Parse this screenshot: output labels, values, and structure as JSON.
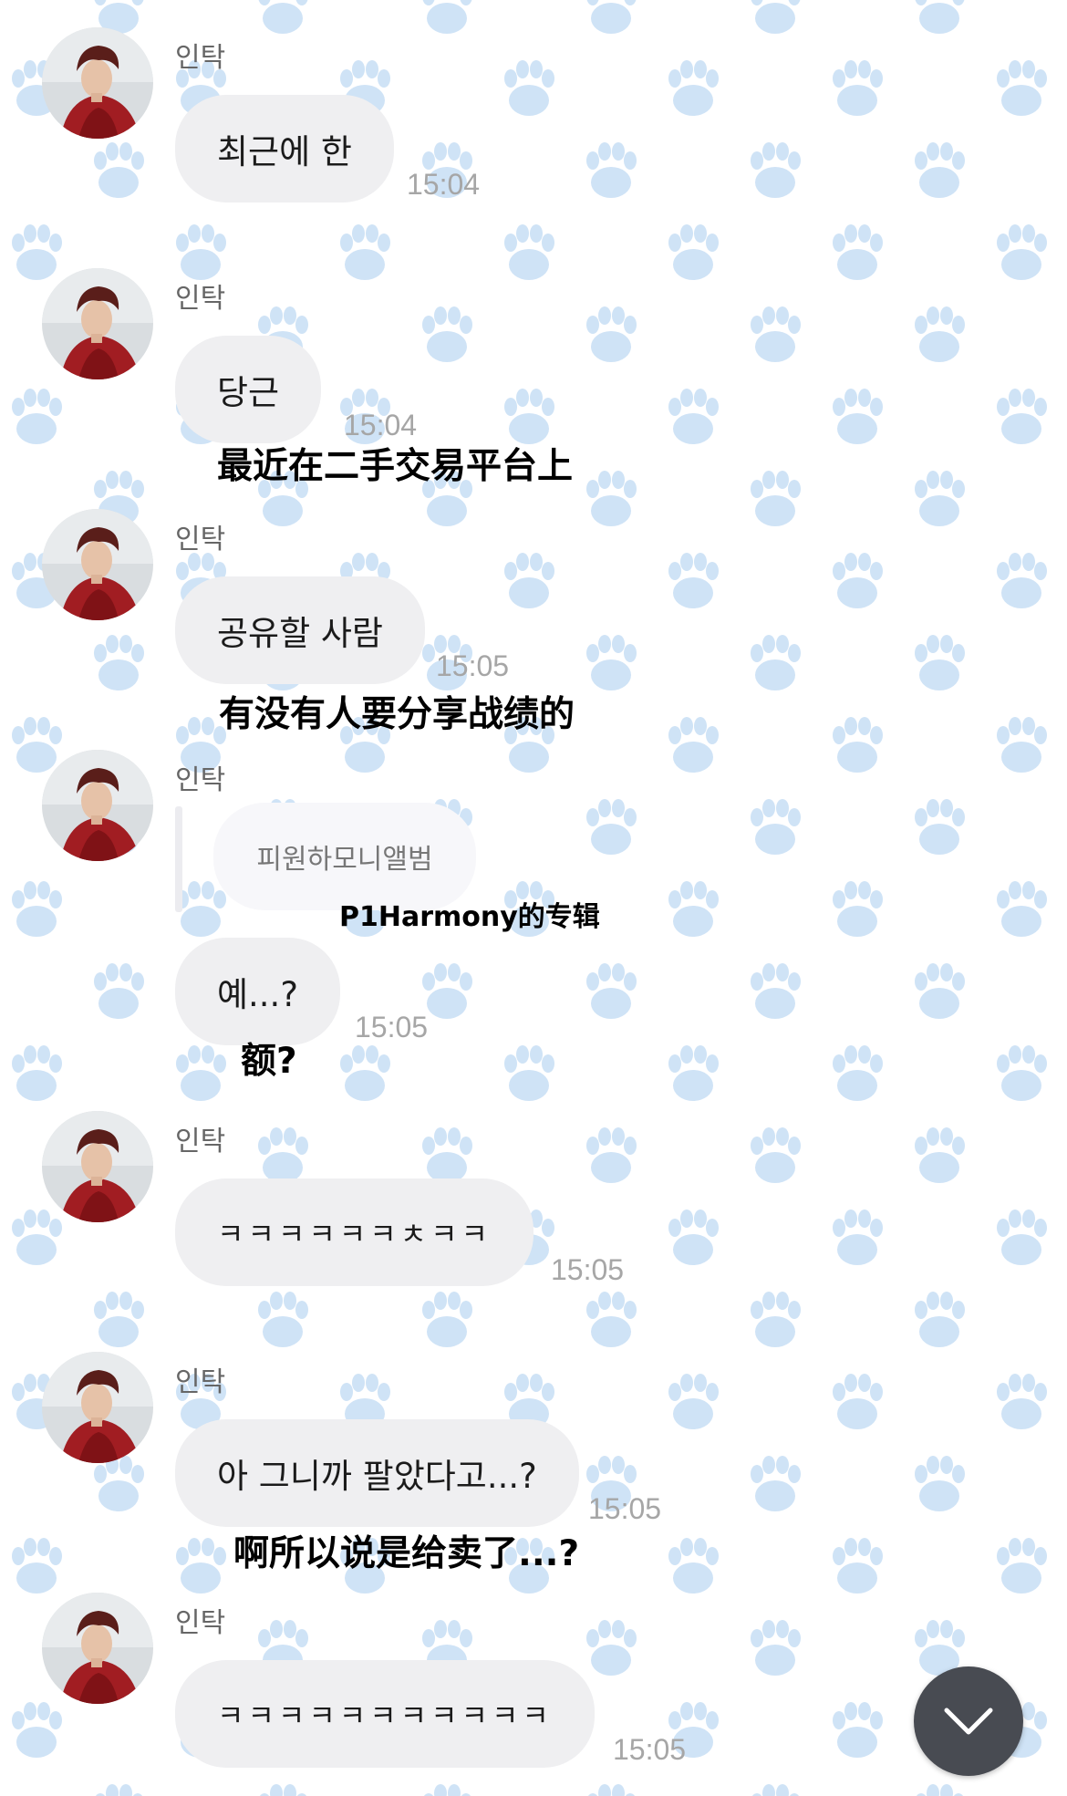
{
  "sender_name": "인탁",
  "messages": [
    {
      "text": "최근에 한",
      "time": "15:04",
      "translation": ""
    },
    {
      "text": "당근",
      "time": "15:04",
      "translation": "最近在二手交易平台上"
    },
    {
      "text": "공유할 사람",
      "time": "15:05",
      "translation": "有没有人要分享战绩的"
    },
    {
      "reply_text": "피원하모니앨범",
      "reply_translation": "P1Harmony的专辑",
      "text": "예...?",
      "time": "15:05",
      "translation": "额?"
    },
    {
      "text": "ㅋㅋㅋㅋㅋㅋㅊㅋㅋ",
      "time": "15:05",
      "translation": ""
    },
    {
      "text": "아 그니까 팔았다고...?",
      "time": "15:05",
      "translation": "啊所以说是给卖了...?"
    },
    {
      "text": "ㅋㅋㅋㅋㅋㅋㅋㅋㅋㅋㅋ",
      "time": "15:05",
      "translation": ""
    }
  ],
  "avatar_icon": "profile-photo",
  "scroll_button_icon": "chevron-down-icon",
  "colors": {
    "background": "#ffffff",
    "paw_pattern": "#cfe3f6",
    "bubble": "#efeff1",
    "time_text": "#a6a6a6",
    "scroll_button": "#484b52"
  }
}
